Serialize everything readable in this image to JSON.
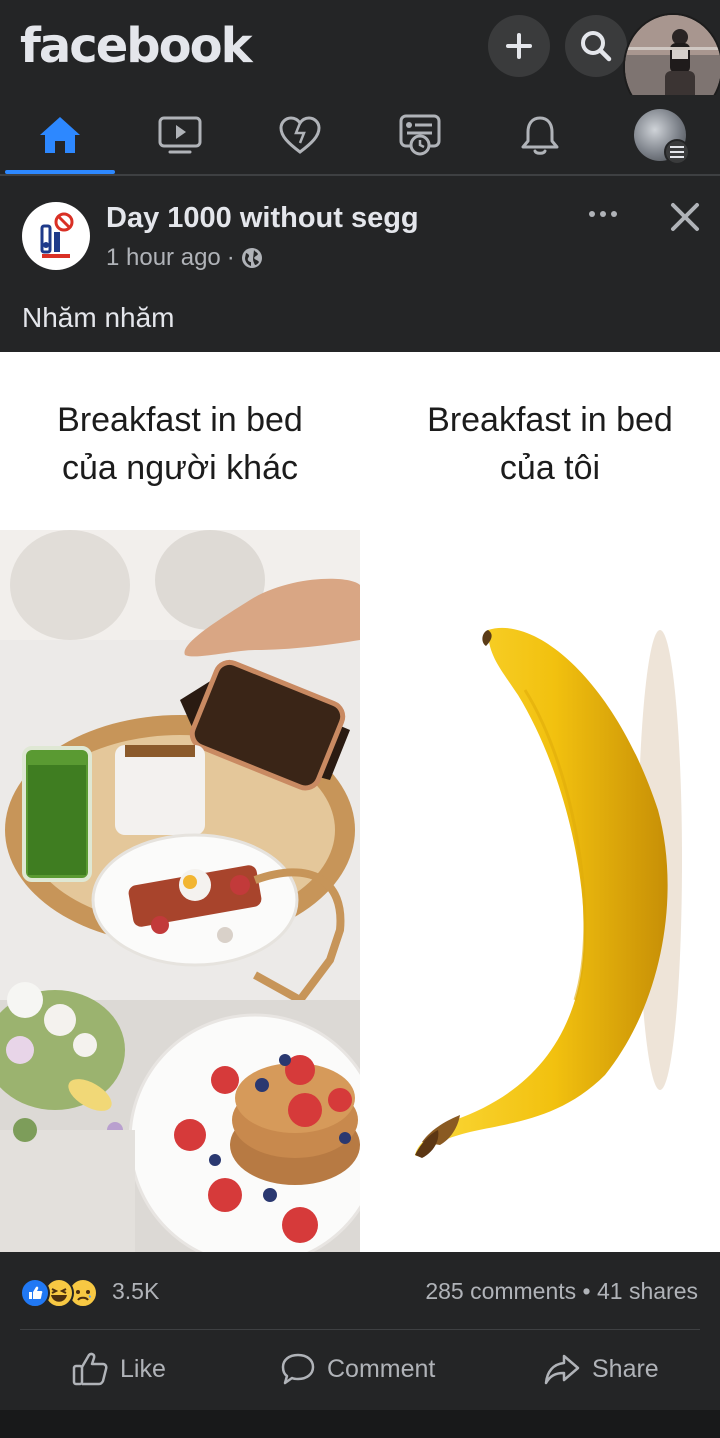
{
  "app": {
    "logo": "facebook"
  },
  "nav": {
    "tabs": [
      {
        "name": "home",
        "active": true
      },
      {
        "name": "watch",
        "active": false
      },
      {
        "name": "dating",
        "active": false
      },
      {
        "name": "memories",
        "active": false
      },
      {
        "name": "notifications",
        "active": false
      },
      {
        "name": "menu",
        "active": false
      }
    ]
  },
  "post": {
    "page_name": "Day 1000 without segg",
    "time": "1 hour ago",
    "separator": "·",
    "caption": "Nhăm nhăm",
    "meme": {
      "left_title_line1": "Breakfast in bed",
      "left_title_line2": "của người khác",
      "right_title_line1": "Breakfast in bed",
      "right_title_line2": "của tôi"
    },
    "reactions": {
      "count": "3.5K",
      "types": [
        "like",
        "haha",
        "sad"
      ]
    },
    "engagement": "285 comments • 41 shares",
    "actions": {
      "like": "Like",
      "comment": "Comment",
      "share": "Share"
    }
  },
  "colors": {
    "background": "#242526",
    "accent": "#2d88ff",
    "text_primary": "#e4e6eb",
    "text_secondary": "#b0b3b8",
    "banana": "#f5c516"
  }
}
